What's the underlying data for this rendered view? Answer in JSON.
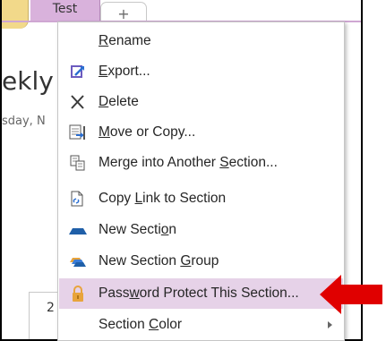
{
  "tabs": {
    "active_label": "Test",
    "add_label": "+"
  },
  "page": {
    "title_partial": "ekly",
    "date_partial": "sday, N",
    "content_partial": "2"
  },
  "menu": {
    "items": [
      {
        "label_pre": "",
        "label_key": "R",
        "label_post": "ename",
        "icon": "none",
        "has_submenu": false,
        "highlighted": false
      },
      {
        "label_pre": "",
        "label_key": "E",
        "label_post": "xport...",
        "icon": "export-icon",
        "has_submenu": false,
        "highlighted": false
      },
      {
        "label_pre": "",
        "label_key": "D",
        "label_post": "elete",
        "icon": "delete-x-icon",
        "has_submenu": false,
        "highlighted": false
      },
      {
        "label_pre": "",
        "label_key": "M",
        "label_post": "ove or Copy...",
        "icon": "move-copy-icon",
        "has_submenu": false,
        "highlighted": false
      },
      {
        "label_pre": "Merge into Another ",
        "label_key": "S",
        "label_post": "ection...",
        "icon": "merge-icon",
        "has_submenu": false,
        "highlighted": false
      },
      {
        "label_pre": "Copy ",
        "label_key": "L",
        "label_post": "ink to Section",
        "icon": "copy-link-icon",
        "has_submenu": false,
        "highlighted": false
      },
      {
        "label_pre": "New Secti",
        "label_key": "o",
        "label_post": "n",
        "icon": "new-section-icon",
        "has_submenu": false,
        "highlighted": false
      },
      {
        "label_pre": "New Section ",
        "label_key": "G",
        "label_post": "roup",
        "icon": "new-section-group-icon",
        "has_submenu": false,
        "highlighted": false
      },
      {
        "label_pre": "Pass",
        "label_key": "w",
        "label_post": "ord Protect This Section...",
        "icon": "lock-icon",
        "has_submenu": false,
        "highlighted": true
      },
      {
        "label_pre": "Section ",
        "label_key": "C",
        "label_post": "olor",
        "icon": "none",
        "has_submenu": true,
        "highlighted": false
      }
    ]
  },
  "colors": {
    "tab_active": "#d9b2dc",
    "menu_highlight": "#e6d2e8",
    "callout_arrow": "#e00000"
  }
}
